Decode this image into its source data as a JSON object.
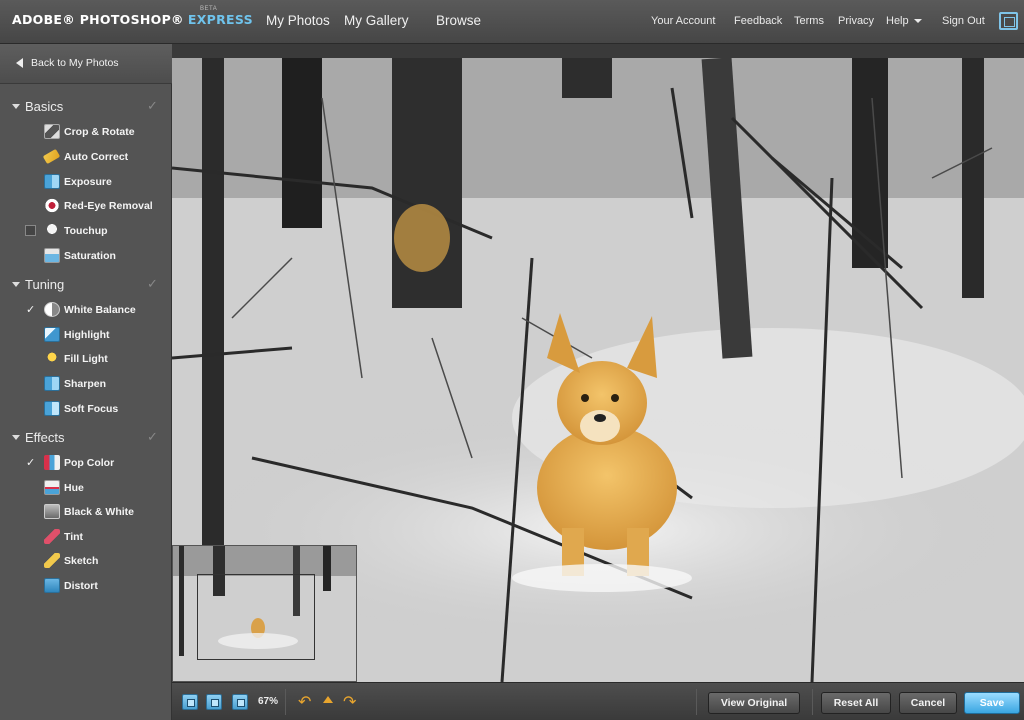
{
  "header": {
    "brand_adobe": "ADOBE® PHOTOSHOP®",
    "brand_express": "EXPRESS",
    "brand_beta": "BETA",
    "nav": [
      "My Photos",
      "My Gallery",
      "Browse"
    ],
    "links": [
      "Your Account",
      "Feedback",
      "Terms",
      "Privacy",
      "Help",
      "Sign Out"
    ]
  },
  "sidebar": {
    "back": "Back to My Photos",
    "sections": [
      {
        "title": "Basics",
        "tools": [
          "Crop & Rotate",
          "Auto Correct",
          "Exposure",
          "Red-Eye Removal",
          "Touchup",
          "Saturation"
        ]
      },
      {
        "title": "Tuning",
        "tools": [
          "White Balance",
          "Highlight",
          "Fill Light",
          "Sharpen",
          "Soft Focus"
        ]
      },
      {
        "title": "Effects",
        "tools": [
          "Pop Color",
          "Hue",
          "Black & White",
          "Tint",
          "Sketch",
          "Distort"
        ]
      }
    ]
  },
  "toolbar": {
    "zoom": "67%",
    "view_original": "View Original",
    "reset_all": "Reset All",
    "cancel": "Cancel",
    "save": "Save"
  },
  "colors": {
    "accent": "#6fc3ec",
    "save_button": "#3aa6e2",
    "undo_redo": "#e8a52e"
  }
}
